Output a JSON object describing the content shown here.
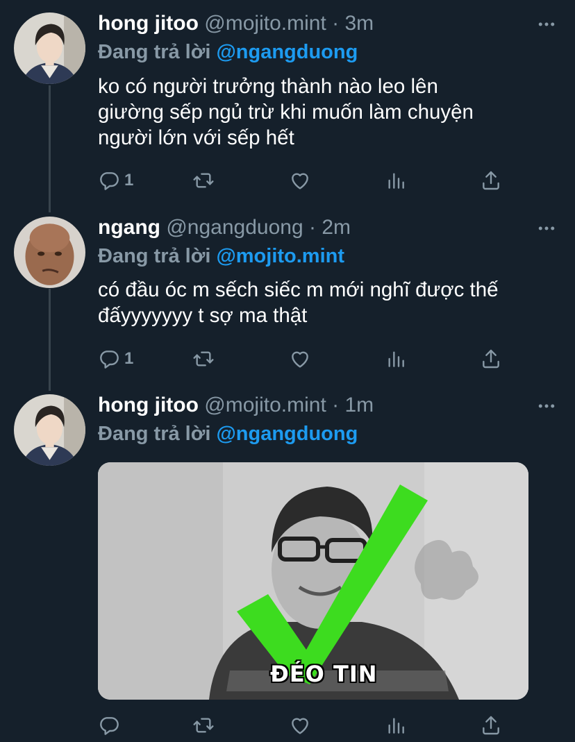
{
  "tweets": [
    {
      "name": "hong jitoo",
      "handle": "@mojito.mint",
      "separator": "·",
      "time": "3m",
      "replying_prefix": "Đang trả lời",
      "replying_to": "@ngangduong",
      "text_lines": [
        "ko có người trưởng thành nào leo lên",
        "giường sếp ngủ trừ khi muốn làm chuyện",
        "người lớn với sếp hết"
      ],
      "reply_count": "1"
    },
    {
      "name": "ngang",
      "handle": "@ngangduong",
      "separator": "·",
      "time": "2m",
      "replying_prefix": "Đang trả lời",
      "replying_to": "@mojito.mint",
      "text_lines": [
        "có đầu óc m sếch siếc m mới nghĩ được thế",
        "đấyyyyyyy t sợ ma thật"
      ],
      "reply_count": "1"
    },
    {
      "name": "hong jitoo",
      "handle": "@mojito.mint",
      "separator": "·",
      "time": "1m",
      "replying_prefix": "Đang trả lời",
      "replying_to": "@ngangduong",
      "media_caption": "ĐÉO TIN",
      "reply_count": ""
    }
  ],
  "colors": {
    "background": "#15202b",
    "muted": "#8899a6",
    "mention": "#1d9bf0",
    "checkmark": "#3ddc1f"
  },
  "icons": [
    "reply-icon",
    "retweet-icon",
    "like-icon",
    "analytics-icon",
    "share-icon",
    "more-icon"
  ]
}
